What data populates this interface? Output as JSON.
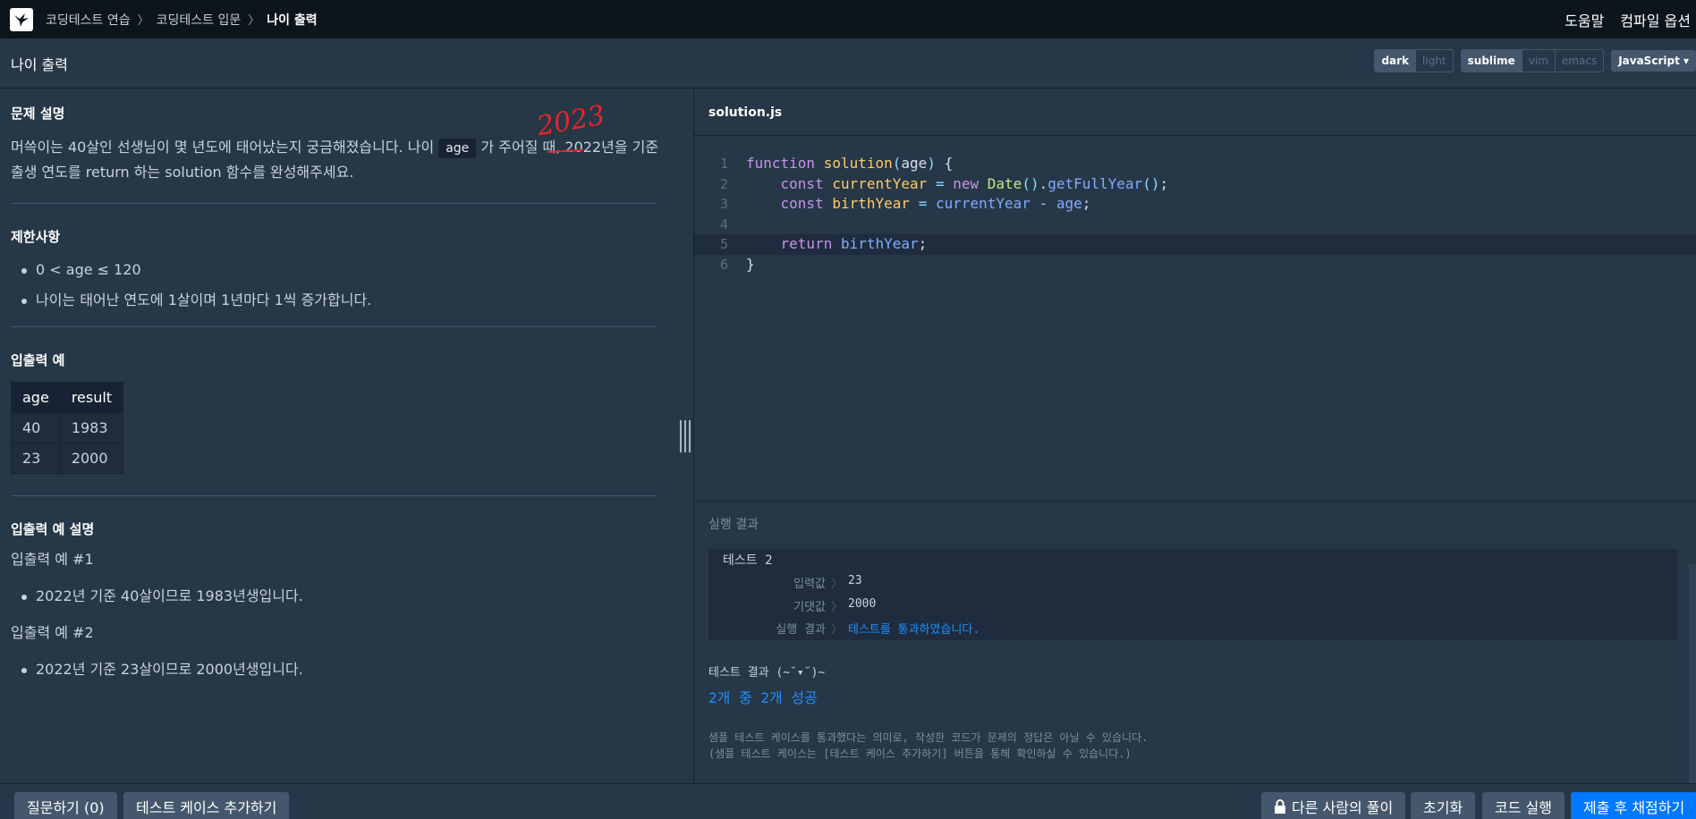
{
  "nav": {
    "crumbs": [
      "코딩테스트 연습",
      "코딩테스트 입문",
      "나이 출력"
    ],
    "separator": "〉",
    "help": "도움말",
    "compile_options": "컴파일 옵션"
  },
  "titlebar": {
    "title": "나이 출력",
    "theme": [
      "dark",
      "light"
    ],
    "keymap": [
      "sublime",
      "vim",
      "emacs"
    ],
    "language": "JavaScript ▾"
  },
  "problem": {
    "desc_heading": "문제 설명",
    "desc_part1": "머쓱이는 40살인 선생님이 몇 년도에 태어났는지 궁금해졌습니다. 나이 ",
    "desc_code": "age",
    "desc_part2": " 가 주어질 때, 2022년을 기준 출생 연도를 return 하는 solution 함수를 완성해주세요.",
    "annotation": "2023",
    "constraints_heading": "제한사항",
    "constraints": [
      "0 < age ≤ 120",
      "나이는 태어난 연도에 1살이며 1년마다 1씩 증가합니다."
    ],
    "io_heading": "입출력 예",
    "io_table": {
      "headers": [
        "age",
        "result"
      ],
      "rows": [
        [
          "40",
          "1983"
        ],
        [
          "23",
          "2000"
        ]
      ]
    },
    "explain_heading": "입출력 예 설명",
    "explain_1_title": "입출력 예 #1",
    "explain_1_items": [
      "2022년 기준 40살이므로 1983년생입니다."
    ],
    "explain_2_title": "입출력 예 #2",
    "explain_2_items": [
      "2022년 기준 23살이므로 2000년생입니다."
    ]
  },
  "editor": {
    "filename": "solution.js",
    "line_numbers": [
      "1",
      "2",
      "3",
      "4",
      "5",
      "6"
    ]
  },
  "result": {
    "title": "실행 결과",
    "test_name": "테스트 2",
    "input_label": "입력값",
    "input_value": "23",
    "expected_label": "기댓값",
    "expected_value": "2000",
    "run_label": "실행 결과",
    "run_value": "테스트를 통과하였습니다.",
    "arrow": "〉",
    "summary_label": "테스트 결과 (~˘▾˘)~",
    "summary_value": "2개 중 2개 성공",
    "note_1": "샘플 테스트 케이스를 통과했다는 의미로, 작성한 코드가 문제의 정답은 아닐 수 있습니다.",
    "note_2": "(샘플 테스트 케이스는 [테스트 케이스 추가하기] 버튼을 통해 확인하실 수 있습니다.)"
  },
  "bottom": {
    "ask": "질문하기 (0)",
    "add_test": "테스트 케이스 추가하기",
    "others": "다른 사람의 풀이",
    "reset": "초기화",
    "run": "코드 실행",
    "submit": "제출 후 채점하기"
  },
  "colors": {
    "background": "#263747",
    "nav": "#0c151c",
    "primary": "#0078ff",
    "annotation": "#e8232b"
  }
}
